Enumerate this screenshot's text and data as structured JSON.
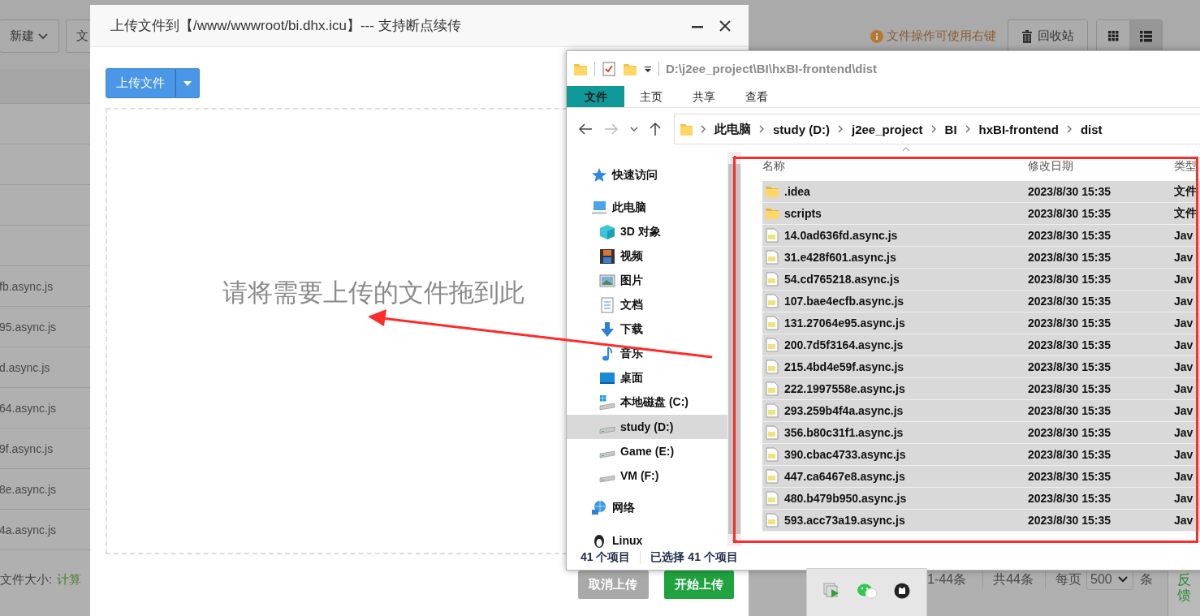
{
  "page": {
    "toolbar": {
      "new_button": "新建",
      "button_2": "文",
      "hint": "文件操作可使用右键",
      "recycle_button": "回收站",
      "view_modes": [
        {
          "kind": "grid",
          "selected": false
        },
        {
          "kind": "list",
          "selected": true
        }
      ]
    },
    "file_rows": [
      "fb.async.js",
      "95.async.js",
      "d.async.js",
      "64.async.js",
      "9f.async.js",
      "8e.async.js",
      "4a.async.js"
    ],
    "footer": {
      "label": "文件大小:",
      "link": "计算"
    },
    "pagination": {
      "range": "1-44条",
      "total": "共44条",
      "per_page_label": "每页",
      "per_page": "500",
      "unit": "条"
    },
    "feedback": "反馈"
  },
  "upload_dialog": {
    "title": "上传文件到【/www/wwwroot/bi.dhx.icu】--- 支持断点续传",
    "upload_button": "上传文件",
    "drop_hint": "请将需要上传的文件拖到此",
    "buttons": [
      {
        "label": "取消上传",
        "disabled": true
      },
      {
        "label": "开始上传",
        "disabled": false
      }
    ]
  },
  "explorer": {
    "title_path": "D:\\j2ee_project\\BI\\hxBI-frontend\\dist",
    "ribbon_tabs": [
      {
        "label": "文件",
        "selected": true
      },
      {
        "label": "主页",
        "selected": false
      },
      {
        "label": "共享",
        "selected": false
      },
      {
        "label": "查看",
        "selected": false
      }
    ],
    "breadcrumb": [
      "此电脑",
      "study (D:)",
      "j2ee_project",
      "BI",
      "hxBI-frontend",
      "dist"
    ],
    "nav": [
      {
        "label": "快速访问",
        "kind": "star",
        "selected": false
      },
      {
        "label": "此电脑",
        "kind": "computer",
        "selected": false,
        "children": [
          {
            "label": "3D 对象",
            "kind": "cube",
            "selected": false
          },
          {
            "label": "视频",
            "kind": "film",
            "selected": false
          },
          {
            "label": "图片",
            "kind": "image",
            "selected": false
          },
          {
            "label": "文档",
            "kind": "doc",
            "selected": false
          },
          {
            "label": "下载",
            "kind": "download",
            "selected": false
          },
          {
            "label": "音乐",
            "kind": "music",
            "selected": false
          },
          {
            "label": "桌面",
            "kind": "desktop",
            "selected": false
          },
          {
            "label": "本地磁盘 (C:)",
            "kind": "windrive",
            "selected": false
          },
          {
            "label": "study (D:)",
            "kind": "drive",
            "selected": true
          },
          {
            "label": "Game (E:)",
            "kind": "drive",
            "selected": false
          },
          {
            "label": "VM (F:)",
            "kind": "drive",
            "selected": false
          }
        ]
      },
      {
        "label": "网络",
        "kind": "network",
        "selected": false
      },
      {
        "label": "Linux",
        "kind": "penguin",
        "selected": false
      }
    ],
    "columns": [
      "名称",
      "修改日期",
      "类型"
    ],
    "files": [
      {
        "name": ".idea",
        "modified": "2023/8/30 15:35",
        "type": "文件",
        "kind": "folder",
        "selected": true
      },
      {
        "name": "scripts",
        "modified": "2023/8/30 15:35",
        "type": "文件",
        "kind": "folder",
        "selected": true
      },
      {
        "name": "14.0ad636fd.async.js",
        "modified": "2023/8/30 15:35",
        "type": "Jav",
        "kind": "js",
        "selected": true
      },
      {
        "name": "31.e428f601.async.js",
        "modified": "2023/8/30 15:35",
        "type": "Jav",
        "kind": "js",
        "selected": true
      },
      {
        "name": "54.cd765218.async.js",
        "modified": "2023/8/30 15:35",
        "type": "Jav",
        "kind": "js",
        "selected": true
      },
      {
        "name": "107.bae4ecfb.async.js",
        "modified": "2023/8/30 15:35",
        "type": "Jav",
        "kind": "js",
        "selected": true
      },
      {
        "name": "131.27064e95.async.js",
        "modified": "2023/8/30 15:35",
        "type": "Jav",
        "kind": "js",
        "selected": true
      },
      {
        "name": "200.7d5f3164.async.js",
        "modified": "2023/8/30 15:35",
        "type": "Jav",
        "kind": "js",
        "selected": true
      },
      {
        "name": "215.4bd4e59f.async.js",
        "modified": "2023/8/30 15:35",
        "type": "Jav",
        "kind": "js",
        "selected": true
      },
      {
        "name": "222.1997558e.async.js",
        "modified": "2023/8/30 15:35",
        "type": "Jav",
        "kind": "js",
        "selected": true
      },
      {
        "name": "293.259b4f4a.async.js",
        "modified": "2023/8/30 15:35",
        "type": "Jav",
        "kind": "js",
        "selected": true
      },
      {
        "name": "356.b80c31f1.async.js",
        "modified": "2023/8/30 15:35",
        "type": "Jav",
        "kind": "js",
        "selected": true
      },
      {
        "name": "390.cbac4733.async.js",
        "modified": "2023/8/30 15:35",
        "type": "Jav",
        "kind": "js",
        "selected": true
      },
      {
        "name": "447.ca6467e8.async.js",
        "modified": "2023/8/30 15:35",
        "type": "Jav",
        "kind": "js",
        "selected": true
      },
      {
        "name": "480.b479b950.async.js",
        "modified": "2023/8/30 15:35",
        "type": "Jav",
        "kind": "js",
        "selected": true
      },
      {
        "name": "593.acc73a19.async.js",
        "modified": "2023/8/30 15:35",
        "type": "Jav",
        "kind": "js",
        "selected": true
      }
    ],
    "status": {
      "count": "41 个项目",
      "selected": "已选择 41 个项目"
    }
  }
}
